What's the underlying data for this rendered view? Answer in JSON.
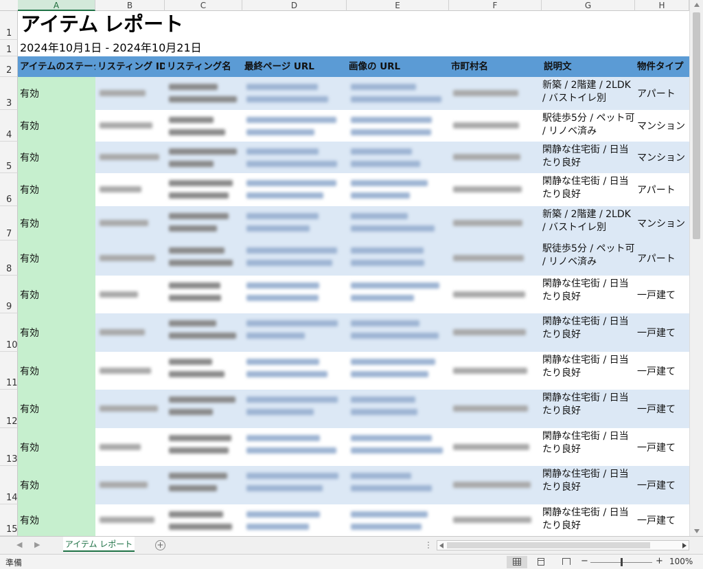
{
  "columns": [
    "A",
    "B",
    "C",
    "D",
    "E",
    "F",
    "G",
    "H"
  ],
  "row_numbers": [
    "1",
    "1",
    "2",
    "3",
    "4",
    "5",
    "6",
    "7",
    "8",
    "9",
    "10",
    "11",
    "12",
    "13",
    "14",
    "15"
  ],
  "report": {
    "title": "アイテム レポート",
    "date_range": "2024年10月1日 - 2024年10月21日"
  },
  "table": {
    "headers": [
      "アイテムのステータス",
      "リスティング ID",
      "リスティング名",
      "最終ページ URL",
      "画像の URL",
      "市町村名",
      "説明文",
      "物件タイプ"
    ],
    "rows": [
      {
        "status": "有効",
        "description": "新築 / 2階建 / 2LDK / バストイレ別",
        "property_type": "アパート"
      },
      {
        "status": "有効",
        "description": "駅徒歩5分 / ペット可 / リノベ済み",
        "property_type": "マンション"
      },
      {
        "status": "有効",
        "description": "閑静な住宅街 / 日当たり良好",
        "property_type": "マンション"
      },
      {
        "status": "有効",
        "description": "閑静な住宅街 / 日当たり良好",
        "property_type": "アパート"
      },
      {
        "status": "有効",
        "description": "新築 / 2階建 / 2LDK / バストイレ別",
        "property_type": "マンション"
      },
      {
        "status": "有効",
        "description": "駅徒歩5分 / ペット可 / リノベ済み",
        "property_type": "アパート"
      },
      {
        "status": "有効",
        "description": "閑静な住宅街 / 日当たり良好",
        "property_type": "一戸建て"
      },
      {
        "status": "有効",
        "description": "閑静な住宅街 / 日当たり良好",
        "property_type": "一戸建て"
      },
      {
        "status": "有効",
        "description": "閑静な住宅街 / 日当たり良好",
        "property_type": "一戸建て"
      },
      {
        "status": "有効",
        "description": "閑静な住宅街 / 日当たり良好",
        "property_type": "一戸建て"
      },
      {
        "status": "有効",
        "description": "閑静な住宅街 / 日当たり良好",
        "property_type": "一戸建て"
      },
      {
        "status": "有効",
        "description": "閑静な住宅街 / 日当たり良好",
        "property_type": "一戸建て"
      },
      {
        "status": "有効",
        "description": "閑静な住宅街 / 日当たり良好",
        "property_type": "一戸建て"
      }
    ]
  },
  "sheet_tab": "アイテム レポート",
  "status_bar": {
    "ready": "準備",
    "zoom": "100%",
    "zoom_minus": "−",
    "zoom_plus": "+"
  },
  "icons": {
    "add_sheet": "plus-circle-icon",
    "more_options": "vertical-ellipsis-icon",
    "nav_left": "triangle-left-icon",
    "nav_right": "triangle-right-icon"
  },
  "colors": {
    "header_fill": "#5b9bd5",
    "status_fill": "#c6efce",
    "band_fill": "#dce8f5",
    "active_tab": "#1e7145"
  }
}
